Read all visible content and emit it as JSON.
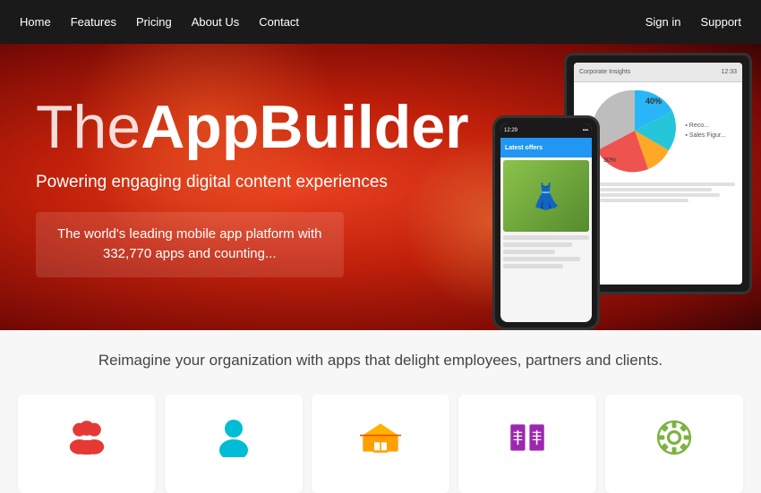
{
  "nav": {
    "left_items": [
      "Home",
      "Features",
      "Pricing",
      "About Us",
      "Contact"
    ],
    "right_items": [
      "Sign in",
      "Support"
    ]
  },
  "hero": {
    "title_thin": "The",
    "title_bold": "AppBuilder",
    "subtitle": "Powering engaging digital content experiences",
    "description": "The world's leading mobile app platform with\n332,770 apps and counting...",
    "bg_colors": {
      "from": "#e84020",
      "to": "#7a0a05"
    }
  },
  "tablet": {
    "header_left": "Corporate Insights",
    "header_right": "12:33",
    "chart_label_40": "40%",
    "chart_label_30": "30%",
    "legend_items": [
      "Reco...",
      "Sales Figur..."
    ]
  },
  "phone": {
    "status_time": "12:29",
    "header_label": "Latest offers",
    "content_label": "Clothing store"
  },
  "subhero": {
    "text": "Reimagine your organization with apps that delight employees, partners and clients."
  },
  "features": [
    {
      "icon": "👥",
      "label": "People",
      "color_class": "icon-people"
    },
    {
      "icon": "👤",
      "label": "Person",
      "color_class": "icon-person"
    },
    {
      "icon": "🏪",
      "label": "Store",
      "color_class": "icon-store"
    },
    {
      "icon": "📚",
      "label": "Books",
      "color_class": "icon-book"
    },
    {
      "icon": "⚙️",
      "label": "Settings",
      "color_class": "icon-cog"
    }
  ]
}
